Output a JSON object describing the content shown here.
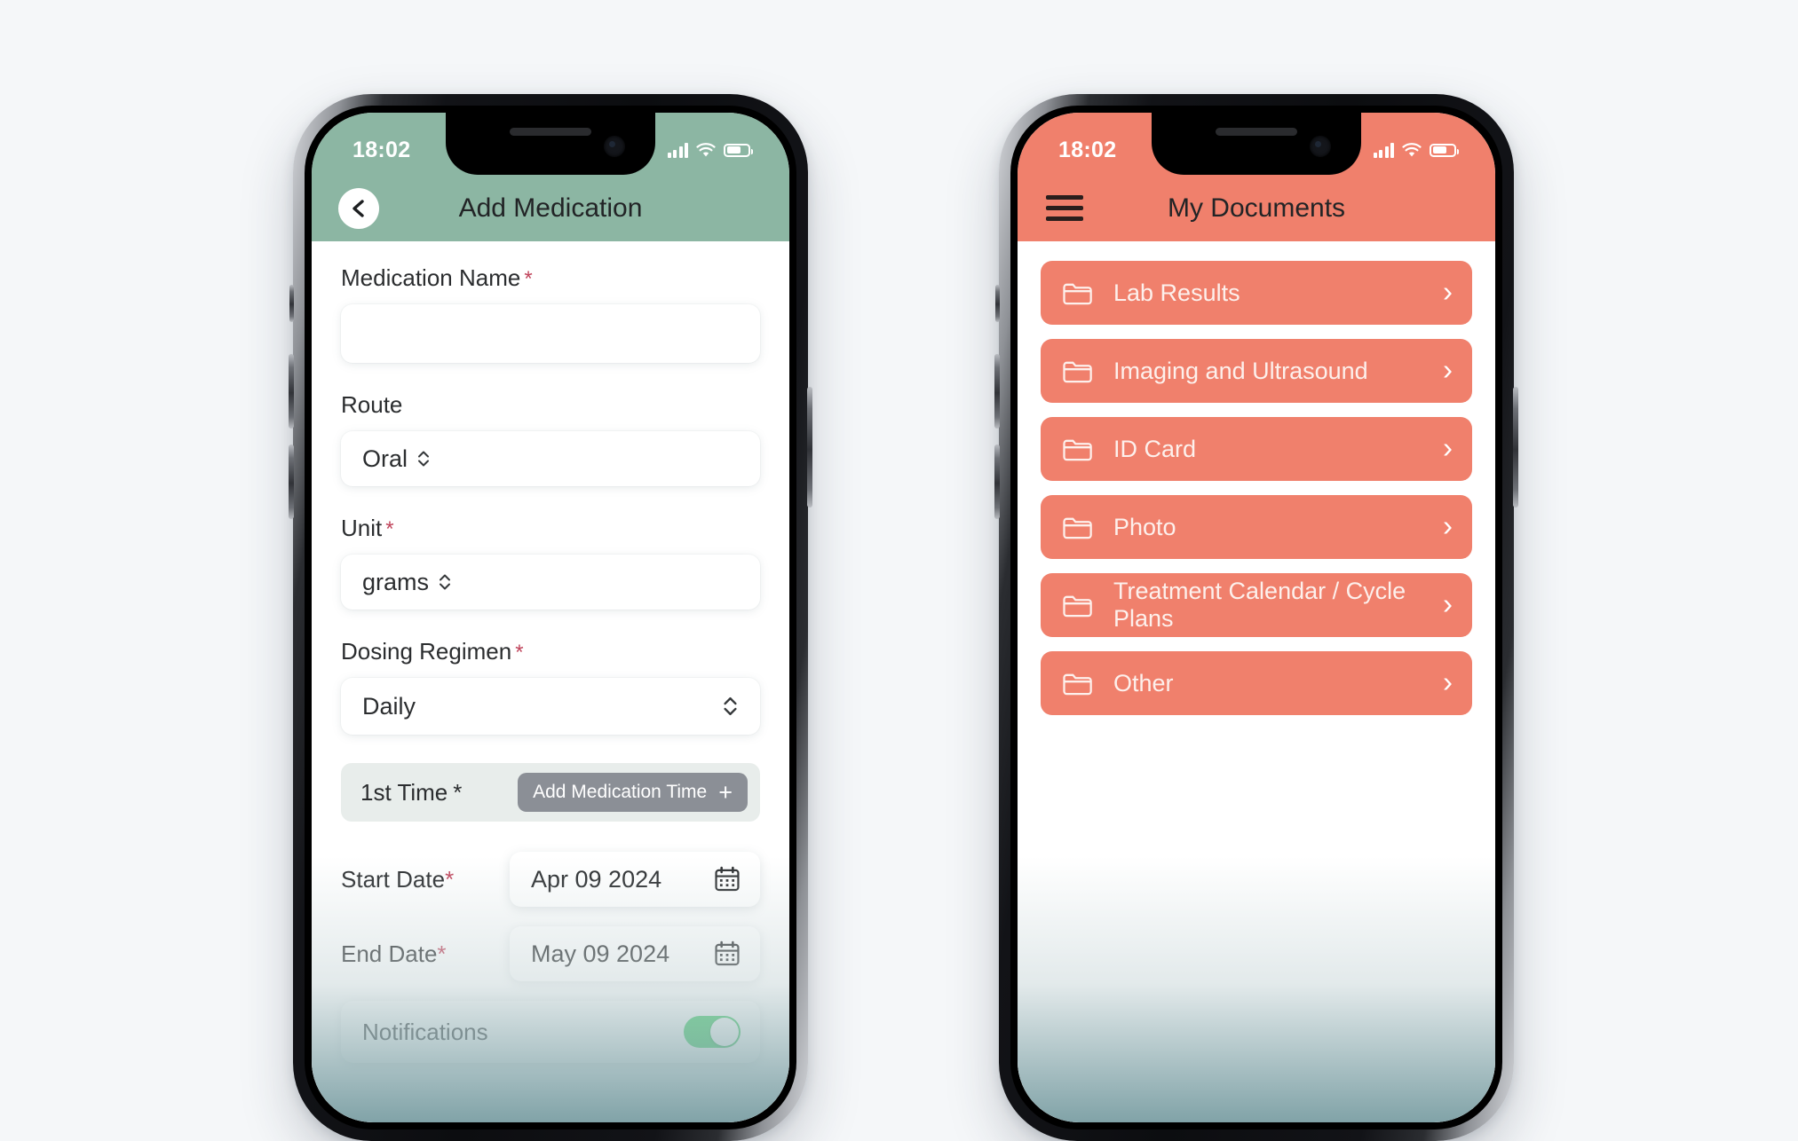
{
  "theme": {
    "green_header": "#8cb6a3",
    "coral_header": "#f0806c",
    "coral_item": "#f0806c",
    "required_star": "#c0455c",
    "gray_button": "#8b8f96",
    "toggle_on": "#2ecc58",
    "page_background": "#f5f7f9"
  },
  "left_phone": {
    "status_bar": {
      "time": "18:02",
      "signal_icon": "cellular-bars-icon",
      "wifi_icon": "wifi-icon",
      "battery_icon": "battery-icon"
    },
    "app_bar": {
      "back_icon": "chevron-left-icon",
      "title": "Add Medication"
    },
    "form": {
      "medication_name": {
        "label": "Medication Name",
        "required_marker": "*",
        "value": "",
        "placeholder": ""
      },
      "route": {
        "label": "Route",
        "required_marker": "",
        "value": "Oral",
        "picker_icon": "chevron-up-down-icon"
      },
      "unit": {
        "label": "Unit",
        "required_marker": "*",
        "value": "grams",
        "picker_icon": "chevron-up-down-icon"
      },
      "dosing_regimen": {
        "label": "Dosing Regimen",
        "required_marker": "*",
        "value": "Daily",
        "picker_icon": "chevron-up-down-icon"
      },
      "first_time": {
        "label": "1st Time",
        "required_marker": "*",
        "add_button_label": "Add Medication Time",
        "add_button_icon": "plus-icon"
      },
      "start_date": {
        "label": "Start Date",
        "required_marker": "*",
        "value": "Apr 09 2024",
        "calendar_icon": "calendar-icon"
      },
      "end_date": {
        "label": "End Date",
        "required_marker": "*",
        "value": "May 09 2024",
        "calendar_icon": "calendar-icon"
      },
      "notifications": {
        "label": "Notifications",
        "toggle_state": "on"
      }
    }
  },
  "right_phone": {
    "status_bar": {
      "time": "18:02",
      "signal_icon": "cellular-bars-icon",
      "wifi_icon": "wifi-icon",
      "battery_icon": "battery-icon"
    },
    "app_bar": {
      "menu_icon": "hamburger-menu-icon",
      "title": "My Documents"
    },
    "documents": [
      {
        "label": "Lab Results",
        "folder_icon": "folder-icon",
        "chevron_icon": "chevron-right-icon"
      },
      {
        "label": "Imaging and Ultrasound",
        "folder_icon": "folder-icon",
        "chevron_icon": "chevron-right-icon"
      },
      {
        "label": "ID Card",
        "folder_icon": "folder-icon",
        "chevron_icon": "chevron-right-icon"
      },
      {
        "label": "Photo",
        "folder_icon": "folder-icon",
        "chevron_icon": "chevron-right-icon"
      },
      {
        "label": "Treatment Calendar / Cycle Plans",
        "folder_icon": "folder-icon",
        "chevron_icon": "chevron-right-icon"
      },
      {
        "label": "Other",
        "folder_icon": "folder-icon",
        "chevron_icon": "chevron-right-icon"
      }
    ]
  }
}
